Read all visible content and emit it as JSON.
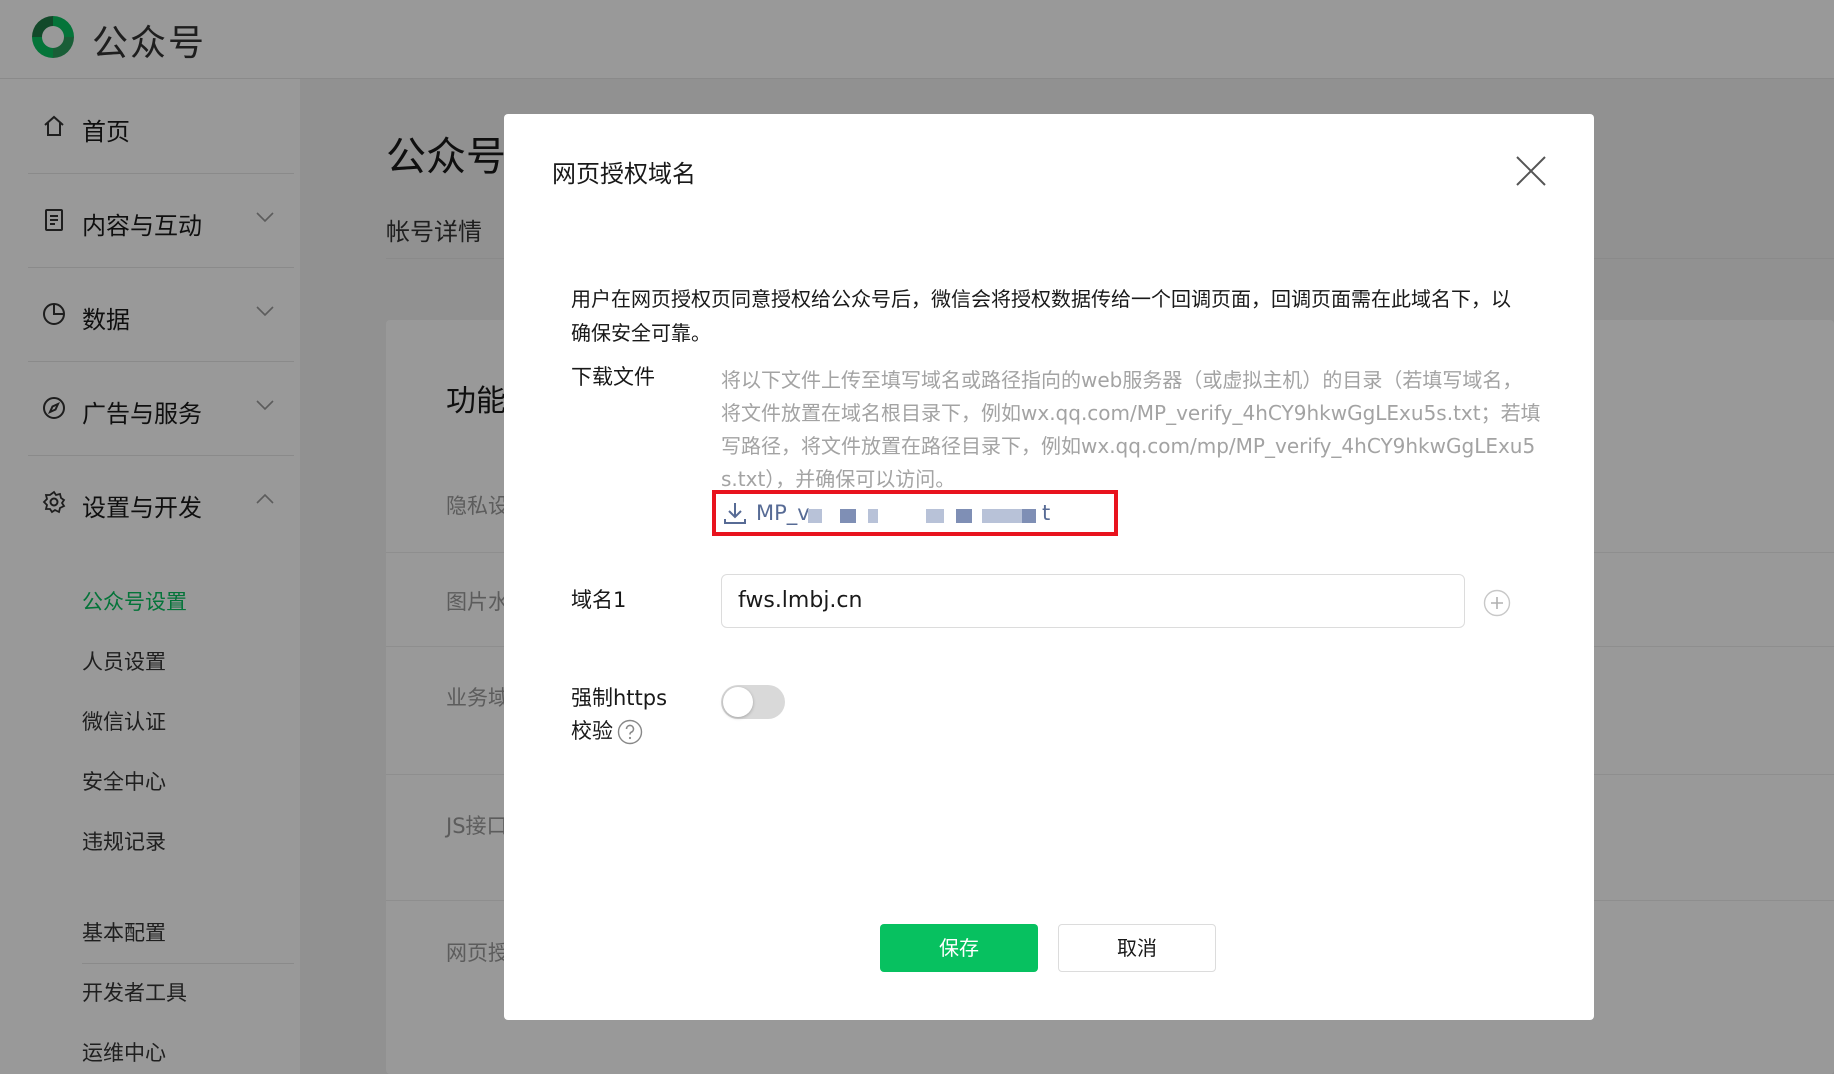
{
  "app": {
    "name": "公众号"
  },
  "sidebar": {
    "items": [
      {
        "label": "首页",
        "icon": "home-icon",
        "expandable": false
      },
      {
        "label": "内容与互动",
        "icon": "document-icon",
        "expandable": true
      },
      {
        "label": "数据",
        "icon": "pie-chart-icon",
        "expandable": true
      },
      {
        "label": "广告与服务",
        "icon": "compass-icon",
        "expandable": true
      },
      {
        "label": "设置与开发",
        "icon": "gear-icon",
        "expandable": true,
        "expanded": true
      }
    ],
    "sub_items": [
      {
        "label": "公众号设置",
        "active": true
      },
      {
        "label": "人员设置"
      },
      {
        "label": "微信认证"
      },
      {
        "label": "安全中心"
      },
      {
        "label": "违规记录"
      },
      {
        "label": "基本配置"
      },
      {
        "label": "开发者工具"
      },
      {
        "label": "运维中心"
      }
    ]
  },
  "main": {
    "title": "公众号",
    "tab": "帐号详情",
    "card_title": "功能",
    "rows": [
      "隐私设",
      "图片水",
      "业务域",
      "JS接口",
      "网页授"
    ]
  },
  "dialog": {
    "title": "网页授权域名",
    "description": "用户在网页授权页同意授权给公众号后，微信会将授权数据传给一个回调页面，回调页面需在此域名下，以确保安全可靠。",
    "download": {
      "label": "下载文件",
      "hint": "将以下文件上传至填写域名或路径指向的web服务器（或虚拟主机）的目录（若填写域名，将文件放置在域名根目录下，例如wx.qq.com/MP_verify_4hCY9hkwGgLExu5s.txt；若填写路径，将文件放置在路径目录下，例如wx.qq.com/mp/MP_verify_4hCY9hkwGgLExu5s.txt），并确保可以访问。",
      "file_prefix": "MP_v",
      "file_suffix": "t"
    },
    "domain": {
      "label": "域名1",
      "value": "fws.lmbj.cn"
    },
    "https": {
      "label_line1": "强制https",
      "label_line2": "校验",
      "enabled": false
    },
    "buttons": {
      "save": "保存",
      "cancel": "取消"
    }
  },
  "colors": {
    "brand_green": "#07c160",
    "highlight_red": "#e8131e",
    "link": "#576b95"
  }
}
